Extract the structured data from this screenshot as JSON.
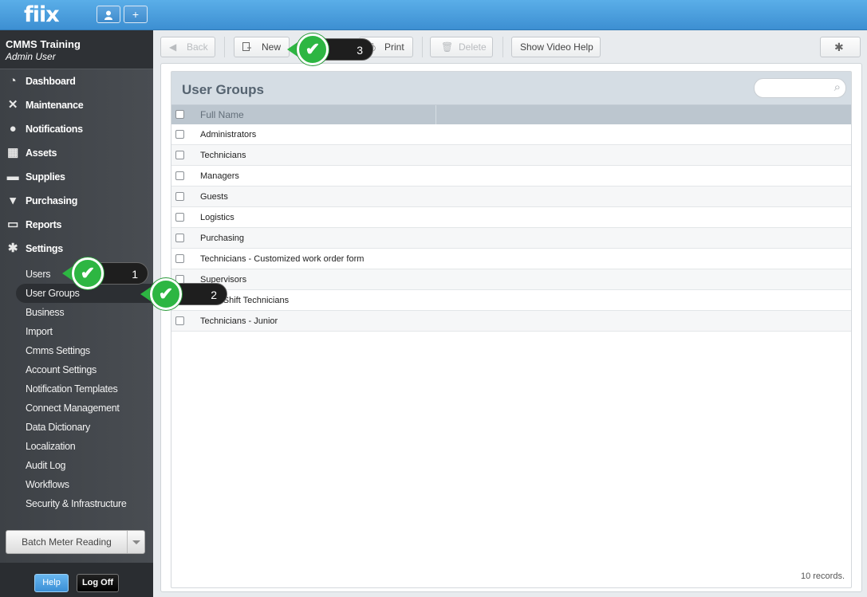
{
  "app": {
    "logo": "fiix",
    "topbar_buttons": [
      {
        "icon": "user-icon",
        "glyph": "👤"
      },
      {
        "icon": "plus-icon",
        "glyph": "+"
      }
    ]
  },
  "company": {
    "name": "CMMS Training",
    "user": "Admin User"
  },
  "nav": [
    {
      "label": "Dashboard",
      "icon": "dashboard-icon",
      "glyph": "◔"
    },
    {
      "label": "Maintenance",
      "icon": "tools-icon",
      "glyph": "✕"
    },
    {
      "label": "Notifications",
      "icon": "speech-bubble-icon",
      "glyph": "●"
    },
    {
      "label": "Assets",
      "icon": "box-icon",
      "glyph": "▦"
    },
    {
      "label": "Supplies",
      "icon": "truck-icon",
      "glyph": "▬"
    },
    {
      "label": "Purchasing",
      "icon": "cart-icon",
      "glyph": "▾"
    },
    {
      "label": "Reports",
      "icon": "chart-icon",
      "glyph": "▭"
    },
    {
      "label": "Settings",
      "icon": "gear-icon",
      "glyph": "✱"
    }
  ],
  "settings_items": [
    "Users",
    "User Groups",
    "Business",
    "Import",
    "Cmms Settings",
    "Account Settings",
    "Notification Templates",
    "Connect Management",
    "Data Dictionary",
    "Localization",
    "Audit Log",
    "Workflows",
    "Security & Infrastructure"
  ],
  "active_settings_item": "User Groups",
  "batch": {
    "label": "Batch Meter Reading"
  },
  "footer": {
    "help": "Help",
    "logoff": "Log Off"
  },
  "toolbar": {
    "back": "Back",
    "new": "New",
    "print": "Print",
    "delete": "Delete",
    "video_help": "Show Video Help"
  },
  "panel": {
    "title": "User Groups",
    "column": "Full Name",
    "rows": [
      "Administrators",
      "Technicians",
      "Managers",
      "Guests",
      "Logistics",
      "Purchasing",
      "Technicians - Customized work order form",
      "Supervisors",
      "Night Shift Technicians",
      "Technicians - Junior"
    ],
    "records": "10 records."
  },
  "callouts": [
    "1",
    "2",
    "3"
  ],
  "colors": {
    "accent": "#3d8fd2",
    "callout_green": "#2db642",
    "sidebar": "#43474c"
  }
}
